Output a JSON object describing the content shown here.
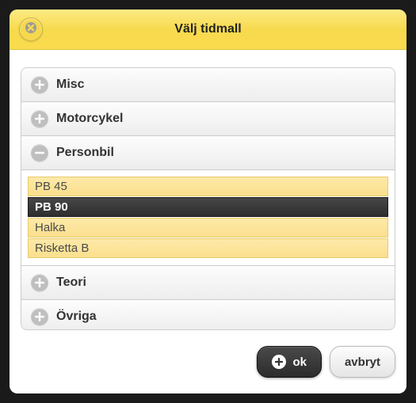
{
  "header": {
    "title": "Välj tidmall"
  },
  "sections": [
    {
      "label": "Misc",
      "expanded": false
    },
    {
      "label": "Motorcykel",
      "expanded": false
    },
    {
      "label": "Personbil",
      "expanded": true,
      "items": [
        {
          "label": "PB 45",
          "selected": false
        },
        {
          "label": "PB 90",
          "selected": true
        },
        {
          "label": "Halka",
          "selected": false
        },
        {
          "label": "Risketta B",
          "selected": false
        }
      ]
    },
    {
      "label": "Teori",
      "expanded": false
    },
    {
      "label": "Övriga",
      "expanded": false
    }
  ],
  "footer": {
    "ok_label": "ok",
    "cancel_label": "avbryt"
  }
}
